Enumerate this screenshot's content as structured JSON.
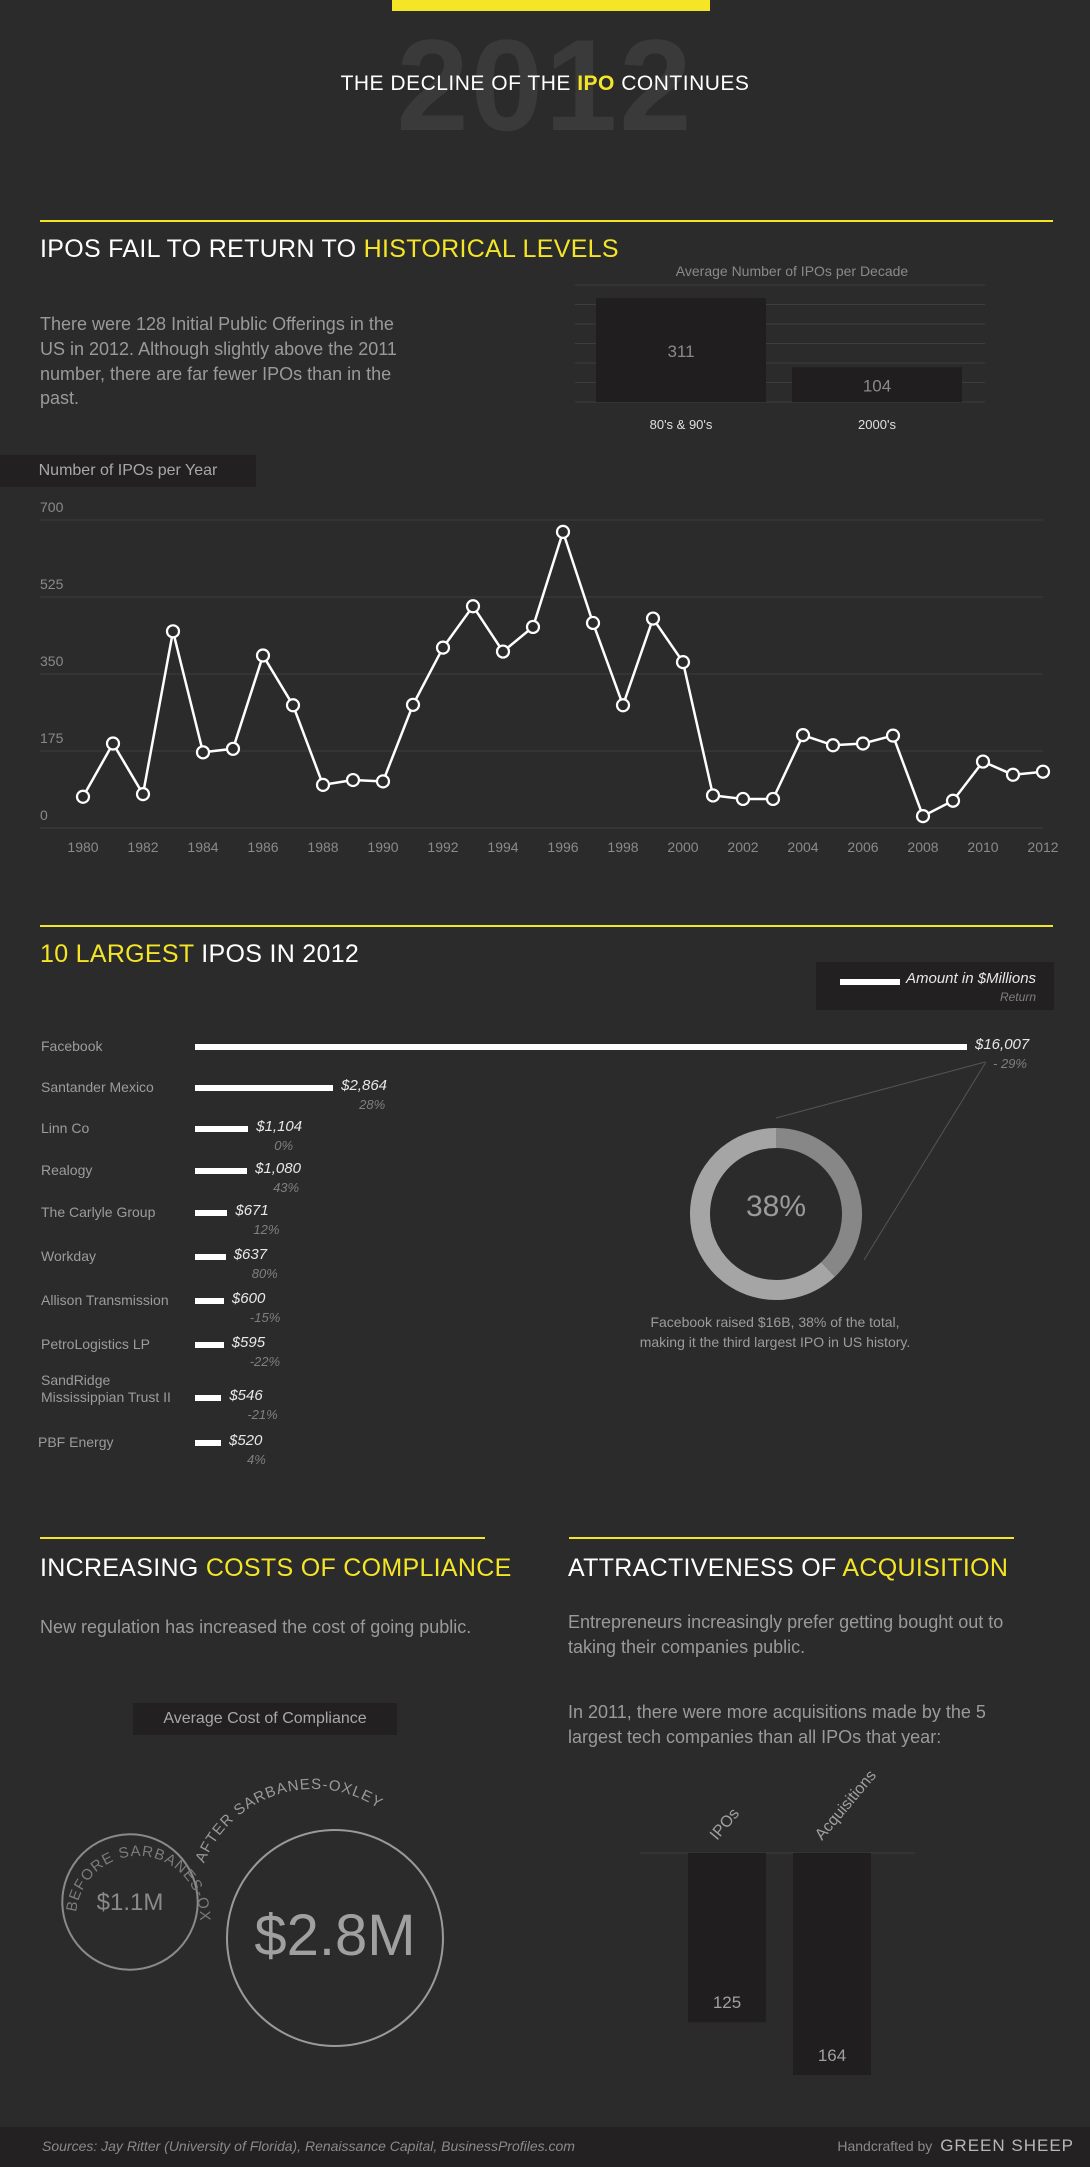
{
  "header": {
    "year": "2012",
    "title_pre": "THE DECLINE OF THE ",
    "title_highlight": "IPO",
    "title_post": " CONTINUES"
  },
  "section1": {
    "title_pre": "IPOS FAIL TO RETURN TO ",
    "title_highlight": "HISTORICAL LEVELS",
    "text": "There were 128 Initial Public Offerings in the US in 2012. Although slightly above the 2011 number, there are far fewer IPOs than in the past."
  },
  "section2": {
    "title_highlight": "10 LARGEST",
    "title_post": " IPOS IN 2012",
    "legend_amount": "Amount in $Millions",
    "legend_return": "Return",
    "donut_value": "38%",
    "donut_caption_1": "Facebook raised $16B, 38% of the total,",
    "donut_caption_2": "making it the third largest IPO in US history."
  },
  "section3": {
    "title_pre": "INCREASING ",
    "title_highlight": "COSTS OF COMPLIANCE",
    "text": "New regulation has increased the cost of going public.",
    "chart_title": "Average Cost of Compliance",
    "before_label": "BEFORE SARBANES-OXLEY",
    "after_label": "AFTER SARBANES-OXLEY",
    "before_value": "$1.1M",
    "after_value": "$2.8M"
  },
  "section4": {
    "title_pre": "ATTRACTIVENESS OF ",
    "title_highlight": "ACQUISITION",
    "text1": "Entrepreneurs increasingly prefer getting bought out to taking their companies public.",
    "text2": "In 2011, there were more acquisitions made by the 5 largest tech companies than all IPOs that year:"
  },
  "footer": {
    "sources": "Sources: Jay Ritter (University of Florida), Renaissance Capital, BusinessProfiles.com",
    "handcrafted": "Handcrafted by",
    "brand": "GREEN SHEEP"
  },
  "colors": {
    "accent": "#f4e526",
    "background": "#2b2b2b",
    "panel": "#232021"
  },
  "chart_data": [
    {
      "type": "bar",
      "title": "Average Number of IPOs per Decade",
      "categories": [
        "80's & 90's",
        "2000's"
      ],
      "values": [
        311,
        104
      ],
      "value_labels": [
        "311",
        "104"
      ],
      "ylim": [
        0,
        350
      ]
    },
    {
      "type": "line",
      "title": "Number of IPOs per Year",
      "x": [
        1980,
        1981,
        1982,
        1983,
        1984,
        1985,
        1986,
        1987,
        1988,
        1989,
        1990,
        1991,
        1992,
        1993,
        1994,
        1995,
        1996,
        1997,
        1998,
        1999,
        2000,
        2001,
        2002,
        2003,
        2004,
        2005,
        2006,
        2007,
        2008,
        2009,
        2010,
        2011,
        2012
      ],
      "y": [
        71,
        192,
        77,
        447,
        172,
        180,
        392,
        279,
        98,
        109,
        106,
        280,
        410,
        504,
        401,
        457,
        673,
        466,
        279,
        476,
        377,
        74,
        66,
        66,
        211,
        188,
        192,
        210,
        27,
        62,
        151,
        121,
        128
      ],
      "xticks": [
        "1980",
        "1982",
        "1984",
        "1986",
        "1988",
        "1990",
        "1992",
        "1994",
        "1996",
        "1998",
        "2000",
        "2002",
        "2004",
        "2006",
        "2008",
        "2010",
        "2012"
      ],
      "yticks": [
        "0",
        "175",
        "350",
        "525",
        "700"
      ],
      "ylim": [
        0,
        700
      ],
      "grid": true
    },
    {
      "type": "bar",
      "title": "10 LARGEST IPOS IN 2012",
      "orientation": "horizontal",
      "categories": [
        "Facebook",
        "Santander Mexico",
        "Linn Co",
        "Realogy",
        "The Carlyle Group",
        "Workday",
        "Allison Transmission",
        "PetroLogistics LP",
        "SandRidge Mississippian Trust II",
        "PBF Energy"
      ],
      "category_lines": [
        [
          "Facebook"
        ],
        [
          "Santander Mexico"
        ],
        [
          "Linn Co"
        ],
        [
          "Realogy"
        ],
        [
          "The Carlyle Group"
        ],
        [
          "Workday"
        ],
        [
          "Allison Transmission"
        ],
        [
          "PetroLogistics LP"
        ],
        [
          "SandRidge",
          "Mississippian Trust II"
        ],
        [
          "PBF Energy"
        ]
      ],
      "values": [
        16007,
        2864,
        1104,
        1080,
        671,
        637,
        600,
        595,
        546,
        520
      ],
      "amount_labels": [
        "$16,007",
        "$2,864",
        "$1,104",
        "$1,080",
        "$671",
        "$637",
        "$600",
        "$595",
        "$546",
        "$520"
      ],
      "returns": [
        "- 29%",
        "28%",
        "0%",
        "43%",
        "12%",
        "80%",
        "-15%",
        "-22%",
        "-21%",
        "4%"
      ],
      "xlim": [
        0,
        16007
      ]
    },
    {
      "type": "pie",
      "title": "Facebook share of total",
      "values": [
        38,
        62
      ],
      "labels": [
        "38%",
        ""
      ]
    },
    {
      "type": "bar",
      "title": "Average Cost of Compliance",
      "categories": [
        "BEFORE SARBANES-OXLEY",
        "AFTER SARBANES-OXLEY"
      ],
      "values": [
        1.1,
        2.8
      ],
      "value_labels": [
        "$1.1M",
        "$2.8M"
      ]
    },
    {
      "type": "bar",
      "title": "IPOs vs Acquisitions 2011",
      "categories": [
        "IPOs",
        "Acquisitions"
      ],
      "values": [
        125,
        164
      ],
      "value_labels": [
        "125",
        "164"
      ],
      "ylim": [
        0,
        164
      ]
    }
  ]
}
